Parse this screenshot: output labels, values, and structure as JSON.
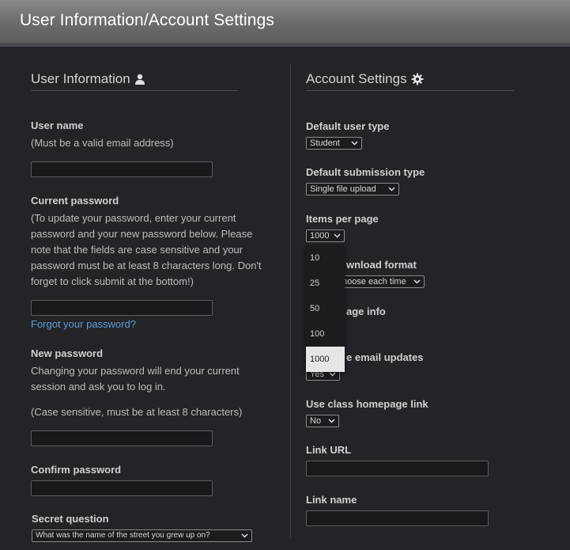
{
  "window": {
    "title": "User Information/Account Settings"
  },
  "user_info": {
    "heading": "User Information",
    "username": {
      "label": "User name",
      "hint": "(Must be a valid email address)",
      "value": ""
    },
    "current_password": {
      "label": "Current password",
      "hint_lines": [
        "(To update your password, enter your current",
        "password and your new password below. Please",
        "note that the fields are case sensitive and your",
        "password must be at least 8 characters long. Don't",
        "forget to click submit at the bottom!)"
      ],
      "forgot_link": "Forgot your password?"
    },
    "new_password": {
      "label": "New password",
      "hint_lines": [
        "Changing your password will end your current",
        "session and ask you to log in."
      ],
      "hint2": "(Case sensitive, must be at least 8 characters)"
    },
    "confirm_password": {
      "label": "Confirm password"
    },
    "secret_question": {
      "label": "Secret question",
      "value": "What was the name of the street you grew up on?"
    }
  },
  "account_settings": {
    "heading": "Account Settings",
    "default_user_type": {
      "label": "Default user type",
      "value": "Student"
    },
    "default_submission_type": {
      "label": "Default submission type",
      "value": "Single file upload"
    },
    "items_per_page": {
      "label": "Items per page",
      "value": "1000",
      "options": [
        "10",
        "25",
        "50",
        "100",
        "1000"
      ]
    },
    "download_format": {
      "label_visible": "wnload format",
      "value_visible": "hoose each time"
    },
    "page_info": {
      "label_visible": "age info"
    },
    "email_updates": {
      "label_visible": "e email updates",
      "value_visible": "Yes"
    },
    "class_homepage_link": {
      "label": "Use class homepage link",
      "value": "No"
    },
    "link_url": {
      "label": "Link URL",
      "value": ""
    },
    "link_name": {
      "label": "Link name",
      "value": ""
    }
  },
  "icons": {
    "user": "user-icon",
    "gear": "gear-icon",
    "chevron": "chevron-down-icon"
  }
}
